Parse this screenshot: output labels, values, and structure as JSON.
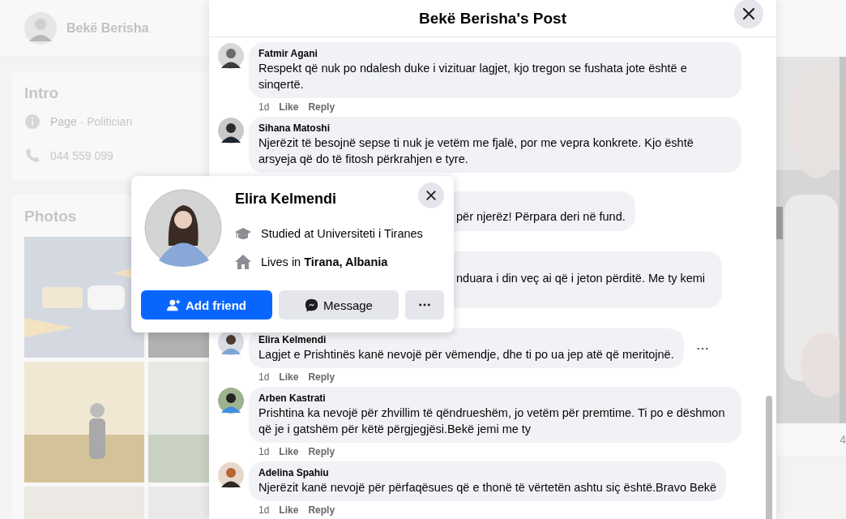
{
  "page": {
    "name": "Bekë Berisha",
    "intro": {
      "title": "Intro",
      "category": "**Page** · Politician",
      "phone": "044 559 099"
    },
    "photos": {
      "title": "Photos"
    },
    "side_count": "4"
  },
  "post_modal": {
    "title": "Bekë Berisha's Post",
    "comments": [
      {
        "kind": "full",
        "author": "Fatmir Agani",
        "text": "Respekt që nuk po ndalesh duke i vizituar lagjet, kjo tregon se fushata jote është e sinqertë.",
        "time": "1d",
        "actions": [
          "Like",
          "Reply"
        ],
        "has_menu": false
      },
      {
        "kind": "full",
        "author": "Sihana Matoshi",
        "text": "Njerëzit të besojnë sepse ti nuk je vetëm me fjalë, por me vepra konkrete. Kjo është arsyeja që do të fitosh përkrahjen e tyre.",
        "has_menu": false
      },
      {
        "kind": "partial",
        "text": "për njerëz! Përpara deri në fund."
      },
      {
        "kind": "partial",
        "text": "nduara i din veç ai që i jeton përditë. Me ty kemi"
      },
      {
        "kind": "full",
        "author": "Elira Kelmendi",
        "text": "Lagjet e Prishtinës kanë nevojë për vëmendje, dhe ti po ua jep atë që meritojnë.",
        "time": "1d",
        "actions": [
          "Like",
          "Reply"
        ],
        "has_menu": true
      },
      {
        "kind": "full",
        "author": "Arben Kastrati",
        "text": "Prishtina ka nevojë për zhvillim të qëndrueshëm, jo vetëm për premtime. Ti po e dëshmon që je i gatshëm për këtë përgjegjësi.Bekë jemi me ty",
        "time": "1d",
        "actions": [
          "Like",
          "Reply"
        ],
        "has_menu": false
      },
      {
        "kind": "full",
        "author": "Adelina Spahiu",
        "text": "Njerëzit kanë nevojë për përfaqësues që e thonë të vërtetën ashtu siç është.Bravo Bekë",
        "time": "1d",
        "actions": [
          "Like",
          "Reply"
        ],
        "has_menu": false
      }
    ]
  },
  "hover_card": {
    "name": "Elira Kelmendi",
    "details": [
      {
        "kind": "education",
        "text": "Studied at Universiteti i Tiranes"
      },
      {
        "kind": "home",
        "text": "Lives in **Tirana, Albania**"
      }
    ],
    "buttons": [
      {
        "kind": "add_friend",
        "label": "Add friend"
      },
      {
        "kind": "message",
        "label": "Message"
      },
      {
        "kind": "more"
      }
    ]
  }
}
